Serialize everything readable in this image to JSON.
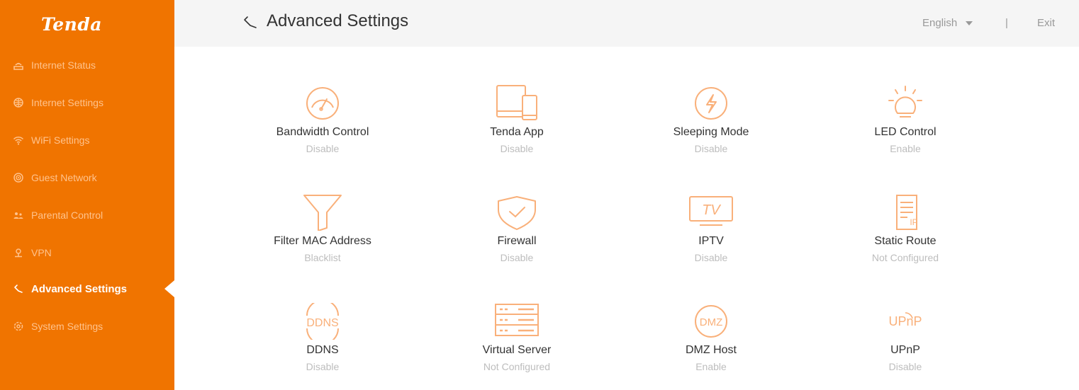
{
  "brand": {
    "logo": "Tenda",
    "accent": "#f07400"
  },
  "sidebar": {
    "items": [
      {
        "label": "Internet Status",
        "icon": "router-icon"
      },
      {
        "label": "Internet Settings",
        "icon": "globe-icon"
      },
      {
        "label": "WiFi Settings",
        "icon": "wifi-icon"
      },
      {
        "label": "Guest Network",
        "icon": "guest-wifi-icon"
      },
      {
        "label": "Parental Control",
        "icon": "parental-icon"
      },
      {
        "label": "VPN",
        "icon": "vpn-icon"
      },
      {
        "label": "Advanced Settings",
        "icon": "tools-icon",
        "active": true
      },
      {
        "label": "System Settings",
        "icon": "gear-icon"
      }
    ]
  },
  "header": {
    "title": "Advanced Settings",
    "language": "English",
    "separator": "|",
    "exit": "Exit"
  },
  "features": [
    {
      "label": "Bandwidth Control",
      "status": "Disable",
      "icon": "speedometer-icon"
    },
    {
      "label": "Tenda App",
      "status": "Disable",
      "icon": "devices-icon"
    },
    {
      "label": "Sleeping Mode",
      "status": "Disable",
      "icon": "lightning-icon"
    },
    {
      "label": "LED Control",
      "status": "Enable",
      "icon": "bulb-icon"
    },
    {
      "label": "Filter MAC Address",
      "status": "Blacklist",
      "icon": "filter-icon"
    },
    {
      "label": "Firewall",
      "status": "Disable",
      "icon": "shield-icon"
    },
    {
      "label": "IPTV",
      "status": "Disable",
      "icon": "tv-icon",
      "icon_text": "TV"
    },
    {
      "label": "Static Route",
      "status": "Not Configured",
      "icon": "route-doc-icon",
      "icon_text": "IP"
    },
    {
      "label": "DDNS",
      "status": "Disable",
      "icon": "ddns-icon",
      "icon_text": "DDNS"
    },
    {
      "label": "Virtual Server",
      "status": "Not Configured",
      "icon": "server-icon"
    },
    {
      "label": "DMZ Host",
      "status": "Enable",
      "icon": "dmz-icon",
      "icon_text": "DMZ"
    },
    {
      "label": "UPnP",
      "status": "Disable",
      "icon": "upnp-icon",
      "icon_text": "UPnP"
    }
  ]
}
